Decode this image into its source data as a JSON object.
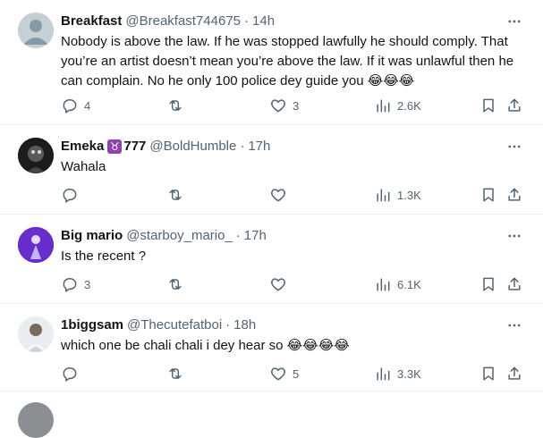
{
  "tweets": [
    {
      "name": "Breakfast",
      "handle": "@Breakfast744675",
      "dot": "·",
      "time": "14h",
      "text": "Nobody is above the law. If he was stopped lawfully he should comply. That you’re an artist doesn’t mean you’re above the law. If it was unlawful then he can complain. No he only 100 police dey guide you 😂😂😂",
      "replies": "4",
      "retweets": "",
      "likes": "3",
      "views": "2.6K"
    },
    {
      "name": "Emeka",
      "name_suffix": "777",
      "handle": "@BoldHumble",
      "dot": "·",
      "time": "17h",
      "text": "Wahala",
      "replies": "",
      "retweets": "",
      "likes": "",
      "views": "1.3K"
    },
    {
      "name": "Big mario",
      "handle": "@starboy_mario_",
      "dot": "·",
      "time": "17h",
      "text": "Is the recent ?",
      "replies": "3",
      "retweets": "",
      "likes": "",
      "views": "6.1K"
    },
    {
      "name": "1biggsam",
      "handle": "@Thecutefatboi",
      "dot": "·",
      "time": "18h",
      "text": "which one be chali chali i dey hear so 😂😂😂😂",
      "replies": "",
      "retweets": "",
      "likes": "5",
      "views": "3.3K"
    }
  ],
  "icons": {
    "reply": "reply-icon",
    "retweet": "retweet-icon",
    "like": "heart-icon",
    "views": "views-icon",
    "bookmark": "bookmark-icon",
    "share": "share-icon",
    "more": "more-icon"
  },
  "colors": {
    "text": "#0f1419",
    "secondary": "#536471",
    "divider": "#eff3f4",
    "zodiac_badge": "#8e44ad"
  }
}
